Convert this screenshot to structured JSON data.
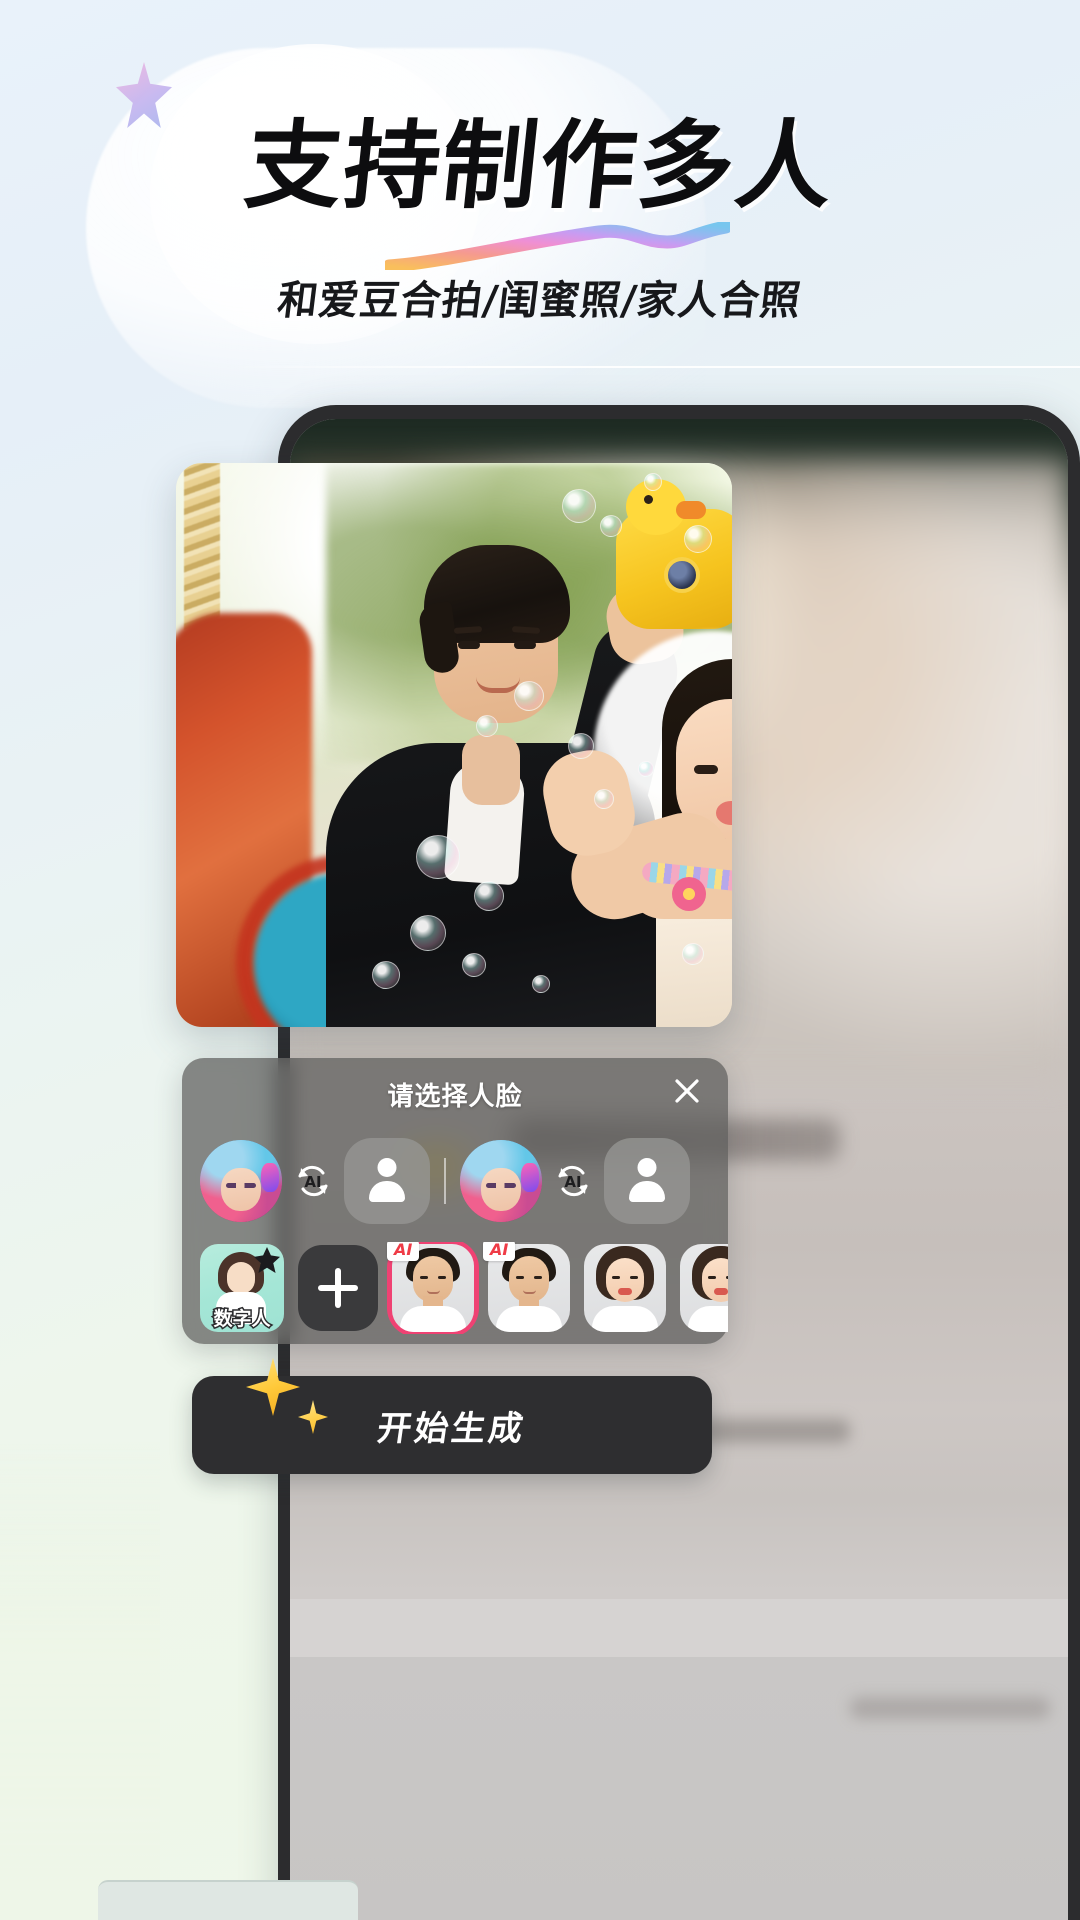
{
  "hero": {
    "headline": "支持制作多人",
    "subtitle": "和爱豆合拍/闺蜜照/家人合照",
    "accent_colors": [
      "#f7b955",
      "#f48fb1",
      "#e39bf0",
      "#b49cf2",
      "#7ec8f0"
    ]
  },
  "app": {
    "face_panel": {
      "title": "请选择人脸",
      "close_label": "×",
      "panel_bg": "#5c5c5a",
      "slots": [
        {
          "name": "slot-1",
          "source_avatar": "anime-girl-headphones-avatar",
          "swap_icon": "ai-swap-icon",
          "target": "empty-person-placeholder"
        },
        {
          "name": "slot-2",
          "source_avatar": "anime-girl-headphones-avatar",
          "swap_icon": "ai-swap-icon",
          "target": "empty-person-placeholder"
        }
      ],
      "gallery": {
        "digital_human": {
          "label": "数字人",
          "icon": "digital-human-avatar",
          "badge": "star-badge"
        },
        "add_button": {
          "icon": "plus-icon",
          "label": "+"
        },
        "faces": [
          {
            "name": "face-1",
            "tag": "AI",
            "kind": "male",
            "selected": true,
            "selected_color": "#ef4273"
          },
          {
            "name": "face-2",
            "tag": "AI",
            "kind": "male",
            "selected": false
          },
          {
            "name": "face-3",
            "tag": "",
            "kind": "female",
            "selected": false
          },
          {
            "name": "face-4",
            "tag": "",
            "kind": "female",
            "selected": false
          }
        ]
      }
    },
    "cta": {
      "label": "开始生成",
      "icon_left": "sparkle-icon",
      "bg": "#2e2e30"
    }
  },
  "photo_card": {
    "name": "couple-bubbles-photo",
    "description": "couple-photo-carousel"
  }
}
